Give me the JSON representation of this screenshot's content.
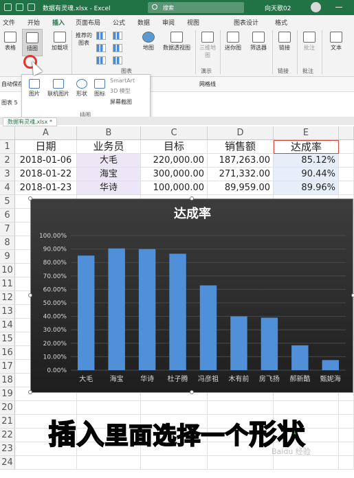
{
  "titlebar": {
    "doc_title": "数据有灵魂.xlsx  -  Excel",
    "search_placeholder": "搜索",
    "user_name": "向天歌02"
  },
  "tabs": [
    "文件",
    "开始",
    "插入",
    "页面布局",
    "公式",
    "数据",
    "审阅",
    "视图",
    "图表设计",
    "格式"
  ],
  "active_tab": "插入",
  "ribbon": {
    "table_label": "表格",
    "illustrations_label": "插图",
    "addins_label": "加载项",
    "recommended_charts_label": "推荐的图表",
    "maps_label": "地图",
    "pivotchart_label": "数据透视图",
    "3dmap_label": "三维地图",
    "sparkline_label": "迷你图",
    "slicer_label": "筛选器",
    "link_label": "链接",
    "comment_label": "批注",
    "text_label": "文本",
    "group_charts": "图表",
    "group_tours": "演示",
    "group_links": "链接",
    "group_comments": "批注"
  },
  "subbar": {
    "autosave_label": "自动保存",
    "gridlines_label": "网格线"
  },
  "dropdown": {
    "picture": "图片",
    "online_picture": "联机图片",
    "shapes": "形状",
    "icons": "图标",
    "smartart": "SmartArt",
    "3d_model": "3D 模型",
    "screenshot": "屏幕截图",
    "group": "插图"
  },
  "namebox": "图表 5",
  "file_tab": "数据有灵魂.xlsx *",
  "columns": [
    "A",
    "B",
    "C",
    "D",
    "E"
  ],
  "row_numbers": [
    "1",
    "2",
    "3",
    "4",
    "5",
    "6",
    "7",
    "8",
    "9",
    "10",
    "11",
    "12",
    "13",
    "14",
    "15",
    "16",
    "17",
    "18",
    "19",
    "20",
    "21",
    "22",
    "23",
    "24"
  ],
  "table": {
    "headers": [
      "日期",
      "业务员",
      "目标",
      "销售额",
      "达成率"
    ],
    "rows": [
      [
        "2018-01-06",
        "大毛",
        "220,000.00",
        "187,263.00",
        "85.12%"
      ],
      [
        "2018-01-22",
        "海宝",
        "300,000.00",
        "271,332.00",
        "90.44%"
      ],
      [
        "2018-01-23",
        "华诗",
        "100,000.00",
        "89,959.00",
        "89.96%"
      ]
    ]
  },
  "chart_data": {
    "type": "bar",
    "title": "达成率",
    "categories": [
      "大毛",
      "海宝",
      "华诗",
      "杜子腾",
      "冯彦祖",
      "木有前",
      "房飞扬",
      "郝新酷",
      "甄妮海"
    ],
    "values": [
      85.12,
      90.44,
      89.96,
      86.5,
      63,
      40,
      39,
      18.5,
      7.5
    ],
    "ylim": [
      0,
      100
    ],
    "yticks": [
      "0.00%",
      "10.00%",
      "20.00%",
      "30.00%",
      "40.00%",
      "50.00%",
      "60.00%",
      "70.00%",
      "80.00%",
      "90.00%",
      "100.00%"
    ],
    "grid": true,
    "bar_color": "#4f90d9",
    "background": "#2b2b2b"
  },
  "caption": {
    "part1": "插入",
    "part2": "里面选择一个",
    "part3": "形状"
  },
  "watermark": "Baidu 经验"
}
